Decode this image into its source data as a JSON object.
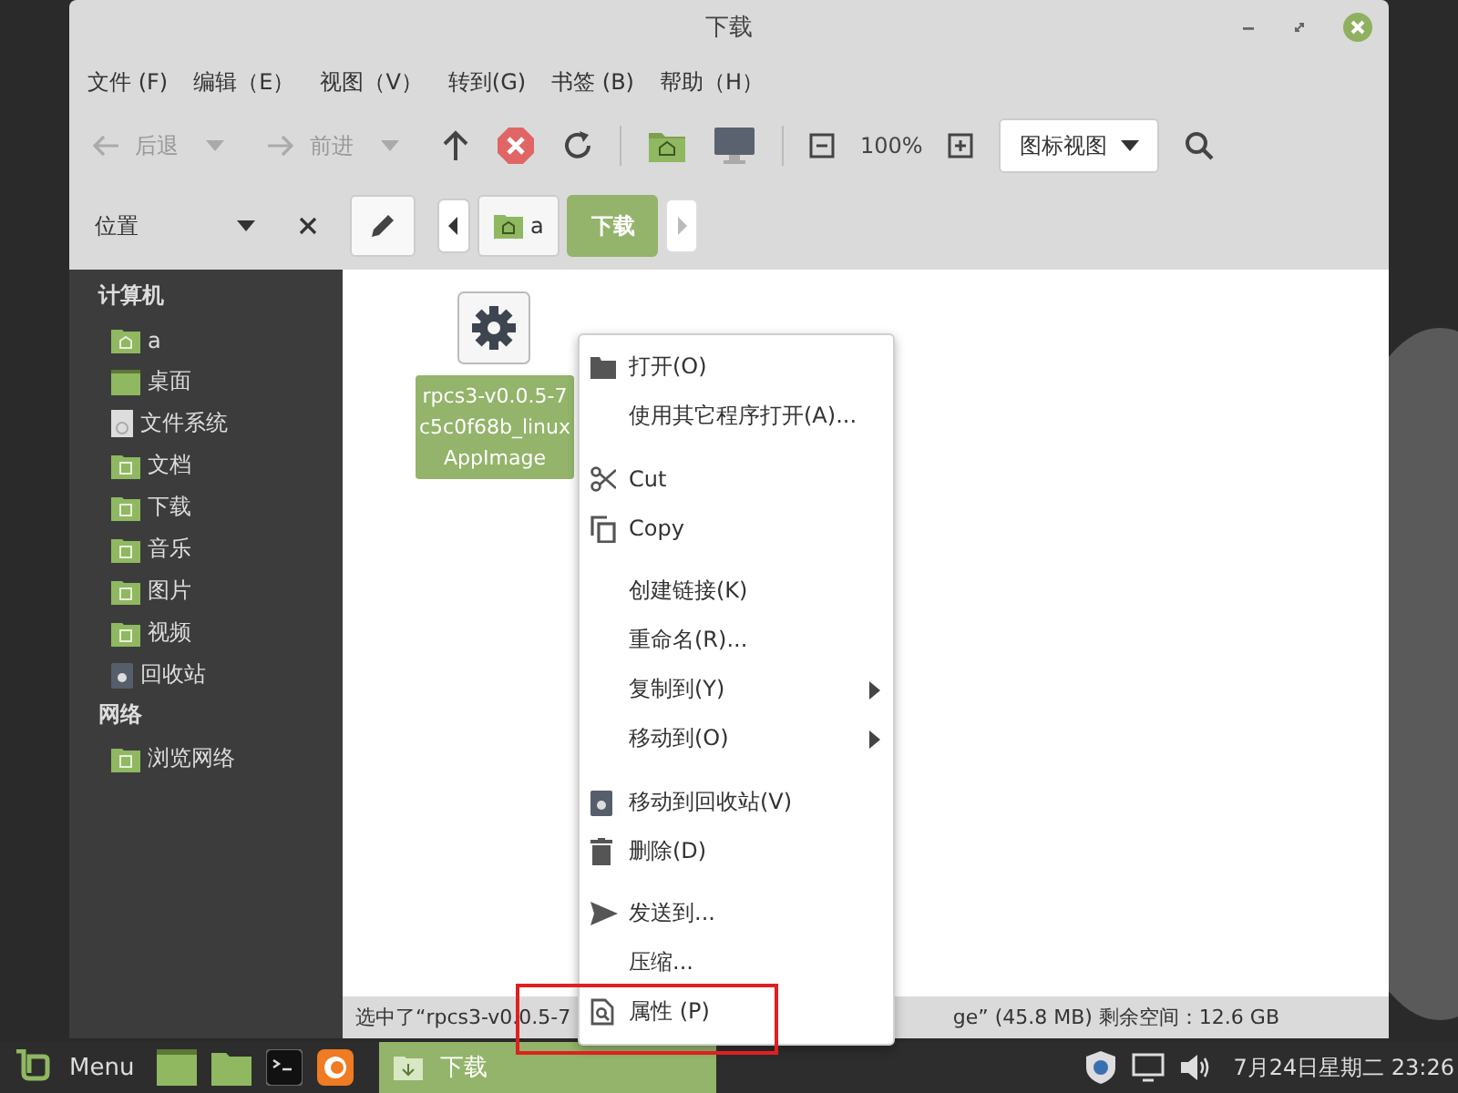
{
  "window": {
    "title": "下载"
  },
  "menu_bar": [
    "文件 (F)",
    "编辑（E）",
    "视图（V）",
    "转到(G)",
    "书签 (B)",
    "帮助（H）"
  ],
  "toolbar": {
    "back": "后退",
    "forward": "前进",
    "zoom": "100%",
    "view_mode": "图标视图"
  },
  "sidebar": {
    "header": "位置",
    "sections": [
      {
        "title": "计算机",
        "items": [
          {
            "label": "a",
            "kind": "home"
          },
          {
            "label": "桌面",
            "kind": "desktop"
          },
          {
            "label": "文件系统",
            "kind": "drive"
          },
          {
            "label": "文档",
            "kind": "folder"
          },
          {
            "label": "下载",
            "kind": "folder"
          },
          {
            "label": "音乐",
            "kind": "folder"
          },
          {
            "label": "图片",
            "kind": "folder"
          },
          {
            "label": "视频",
            "kind": "folder"
          },
          {
            "label": "回收站",
            "kind": "trash"
          }
        ]
      },
      {
        "title": "网络",
        "items": [
          {
            "label": "浏览网络",
            "kind": "folder"
          }
        ]
      }
    ]
  },
  "path_bar": [
    {
      "label": "a",
      "kind": "home",
      "selected": false
    },
    {
      "label": "下载",
      "kind": "plain",
      "selected": true
    }
  ],
  "file": {
    "name_lines": [
      "rpcs3-v0.0.5-7",
      "c5c0f68b_linux",
      "AppImage"
    ],
    "selected": true
  },
  "context_menu": [
    {
      "items": [
        {
          "label": "打开(O)",
          "kind": "folder",
          "submenu": false
        },
        {
          "label": "使用其它程序打开(A)...",
          "kind": "plain",
          "submenu": false
        }
      ]
    },
    {
      "items": [
        {
          "label": "Cut",
          "kind": "scissors",
          "submenu": false
        },
        {
          "label": "Copy",
          "kind": "copy",
          "submenu": false
        }
      ]
    },
    {
      "items": [
        {
          "label": "创建链接(K)",
          "kind": "plain",
          "submenu": false
        },
        {
          "label": "重命名(R)...",
          "kind": "plain",
          "submenu": false
        },
        {
          "label": "复制到(Y)",
          "kind": "plain",
          "submenu": true
        },
        {
          "label": "移动到(O)",
          "kind": "plain",
          "submenu": true
        }
      ]
    },
    {
      "items": [
        {
          "label": "移动到回收站(V)",
          "kind": "trash",
          "submenu": false
        },
        {
          "label": "删除(D)",
          "kind": "bin",
          "submenu": false
        }
      ]
    },
    {
      "items": [
        {
          "label": "发送到...",
          "kind": "send",
          "submenu": false
        },
        {
          "label": "压缩...",
          "kind": "plain",
          "submenu": false
        },
        {
          "label": "属性 (P)",
          "kind": "properties",
          "submenu": false
        }
      ]
    }
  ],
  "status_bar": {
    "left": "选中了“rpcs3-v0.0.5-7",
    "right": "ge” (45.8 MB) 剩余空间：12.6 GB"
  },
  "taskbar": {
    "menu": "Menu",
    "windows": [
      {
        "label": "下载",
        "selected": true
      }
    ],
    "clock": "7月24日星期二 23:26"
  }
}
